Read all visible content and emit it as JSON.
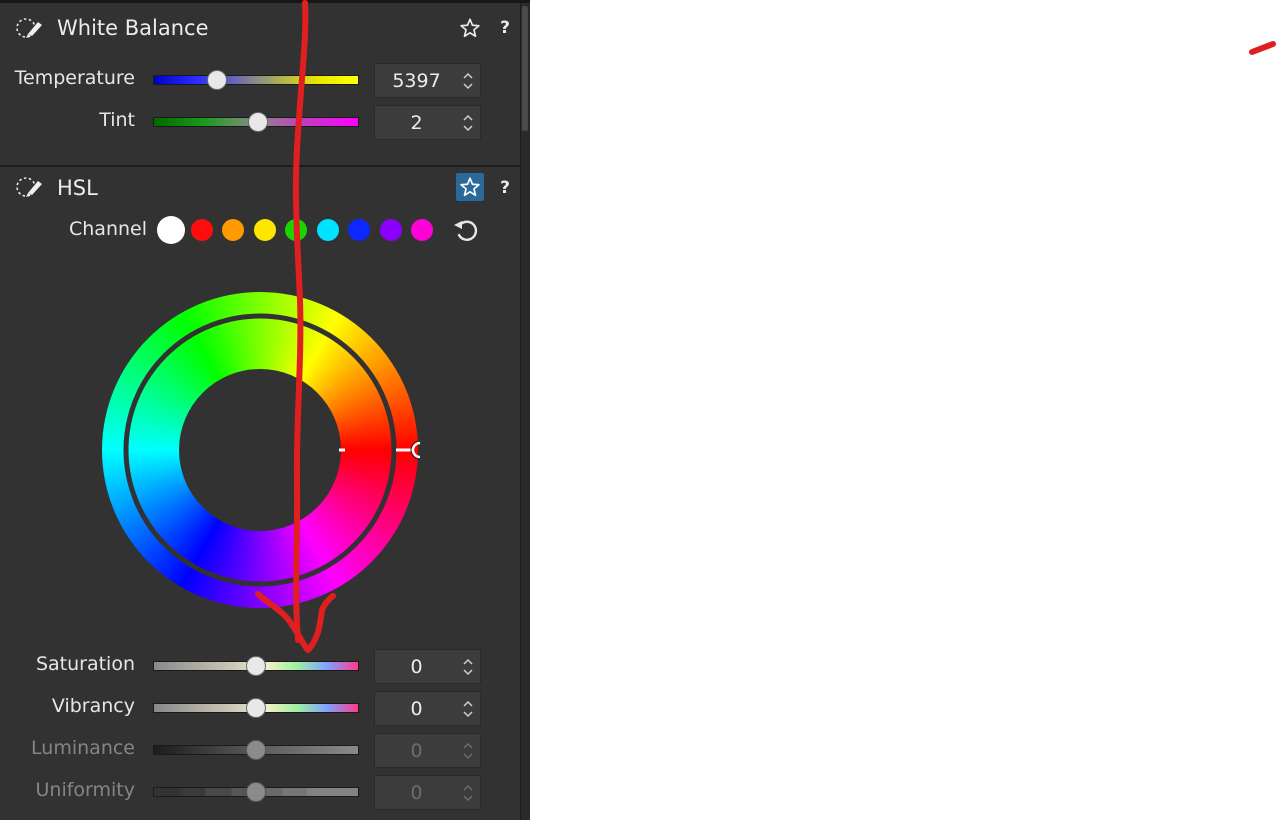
{
  "white_balance": {
    "title": "White Balance",
    "help_label": "?",
    "icons": {
      "section": "eyedropper-icon",
      "favorite": "star-outline-icon"
    },
    "temperature": {
      "label": "Temperature",
      "value": "5397",
      "position": 0.31
    },
    "tint": {
      "label": "Tint",
      "value": "2",
      "position": 0.51
    }
  },
  "hsl": {
    "title": "HSL",
    "help_label": "?",
    "icons": {
      "section": "eyedropper-icon",
      "favorite": "star-outline-icon",
      "reset": "reset-icon"
    },
    "favorite_active": true,
    "channel": {
      "label": "Channel",
      "swatches": [
        {
          "name": "white",
          "color": "#ffffff",
          "selected": true
        },
        {
          "name": "red",
          "color": "#ff0d0d"
        },
        {
          "name": "orange",
          "color": "#ff9a00"
        },
        {
          "name": "yellow",
          "color": "#ffe600"
        },
        {
          "name": "green",
          "color": "#1bd500"
        },
        {
          "name": "aqua",
          "color": "#00e2ff"
        },
        {
          "name": "blue",
          "color": "#0d28ff"
        },
        {
          "name": "purple",
          "color": "#8a00ff"
        },
        {
          "name": "magenta",
          "color": "#ff00d6"
        }
      ]
    },
    "hue_wheel": {
      "handle_angle_deg": 0
    },
    "saturation": {
      "label": "Saturation",
      "value": "0",
      "position": 0.5
    },
    "vibrancy": {
      "label": "Vibrancy",
      "value": "0",
      "position": 0.5
    },
    "luminance": {
      "label": "Luminance",
      "value": "0",
      "position": 0.5,
      "disabled": true
    },
    "uniformity": {
      "label": "Uniformity",
      "value": "0",
      "position": 0.5,
      "disabled": true
    }
  },
  "colors": {
    "panel_bg": "#323232",
    "accent": "#2a6a9a",
    "annotation": "#e02020"
  }
}
